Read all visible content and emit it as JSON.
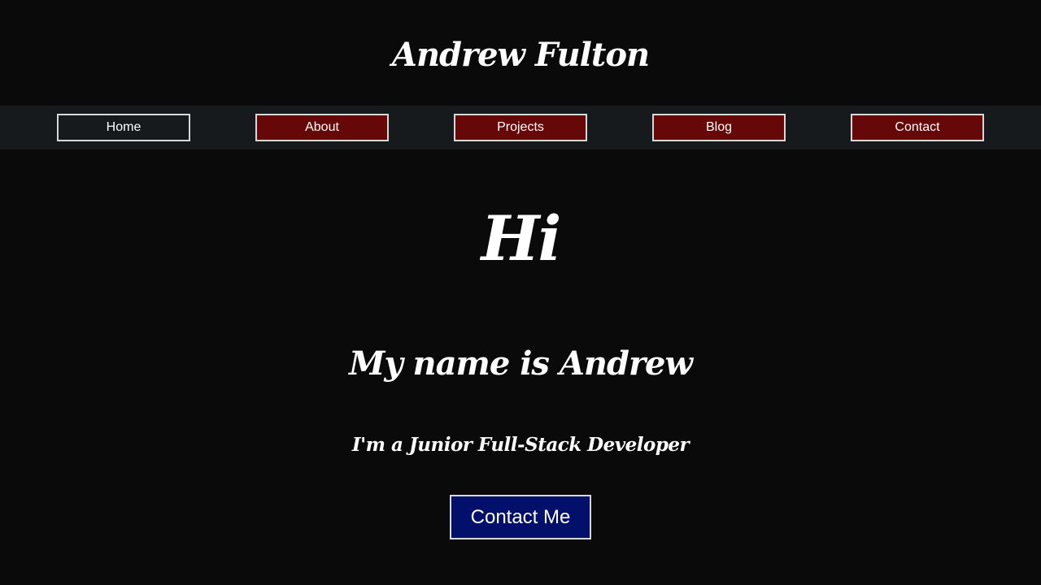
{
  "header": {
    "title": "Andrew Fulton"
  },
  "nav": {
    "items": [
      {
        "label": "Home",
        "active": true
      },
      {
        "label": "About",
        "active": false
      },
      {
        "label": "Projects",
        "active": false
      },
      {
        "label": "Blog",
        "active": false
      },
      {
        "label": "Contact",
        "active": false
      }
    ]
  },
  "hero": {
    "greeting": "Hi",
    "name_line": "My name is Andrew",
    "role_line": "I'm a Junior Full-Stack Developer",
    "cta_label": "Contact Me"
  },
  "colors": {
    "page_background": "#0b0a0b",
    "nav_background": "#161a1d",
    "nav_button": "#660708",
    "cta_button": "#03106b",
    "button_border": "#d8d8d8",
    "text": "#ffffff"
  }
}
